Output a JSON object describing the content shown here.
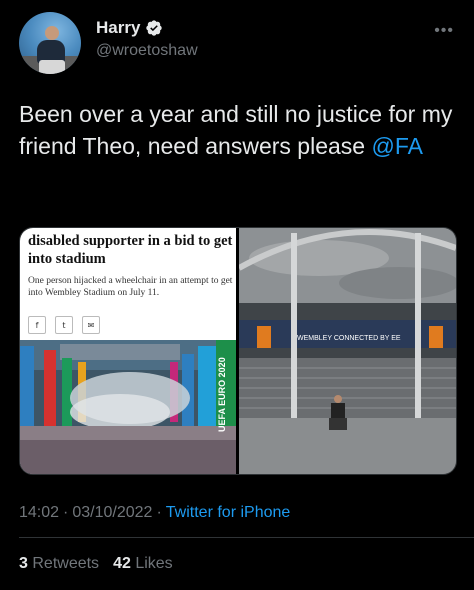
{
  "user": {
    "display_name": "Harry",
    "handle": "@wroetoshaw",
    "verified_icon": "verified-badge-icon",
    "more_icon": "more-horizontal-icon"
  },
  "tweet": {
    "text_before": "Been over a year and still no justice for my friend Theo, need answers please ",
    "mention": "@FA"
  },
  "media": {
    "article_headline": "disabled supporter in a bid to get into stadium",
    "article_subtext": "One person hijacked a wheelchair in an attempt to get into Wembley Stadium on July 11.",
    "share_icons": [
      "facebook-icon",
      "twitter-icon",
      "email-icon"
    ],
    "crowd_banner_text": "UEFA EURO 2020",
    "stadium_sign_text": "WEMBLEY CONNECTED BY EE"
  },
  "meta": {
    "time": "14:02",
    "date": "03/10/2022",
    "separator": "·",
    "source": "Twitter for iPhone"
  },
  "stats": {
    "retweets_count": "3",
    "retweets_label": "Retweets",
    "likes_count": "42",
    "likes_label": "Likes"
  },
  "colors": {
    "background": "#000000",
    "text": "#e7e9ea",
    "secondary": "#71767b",
    "accent": "#1d9bf0"
  }
}
